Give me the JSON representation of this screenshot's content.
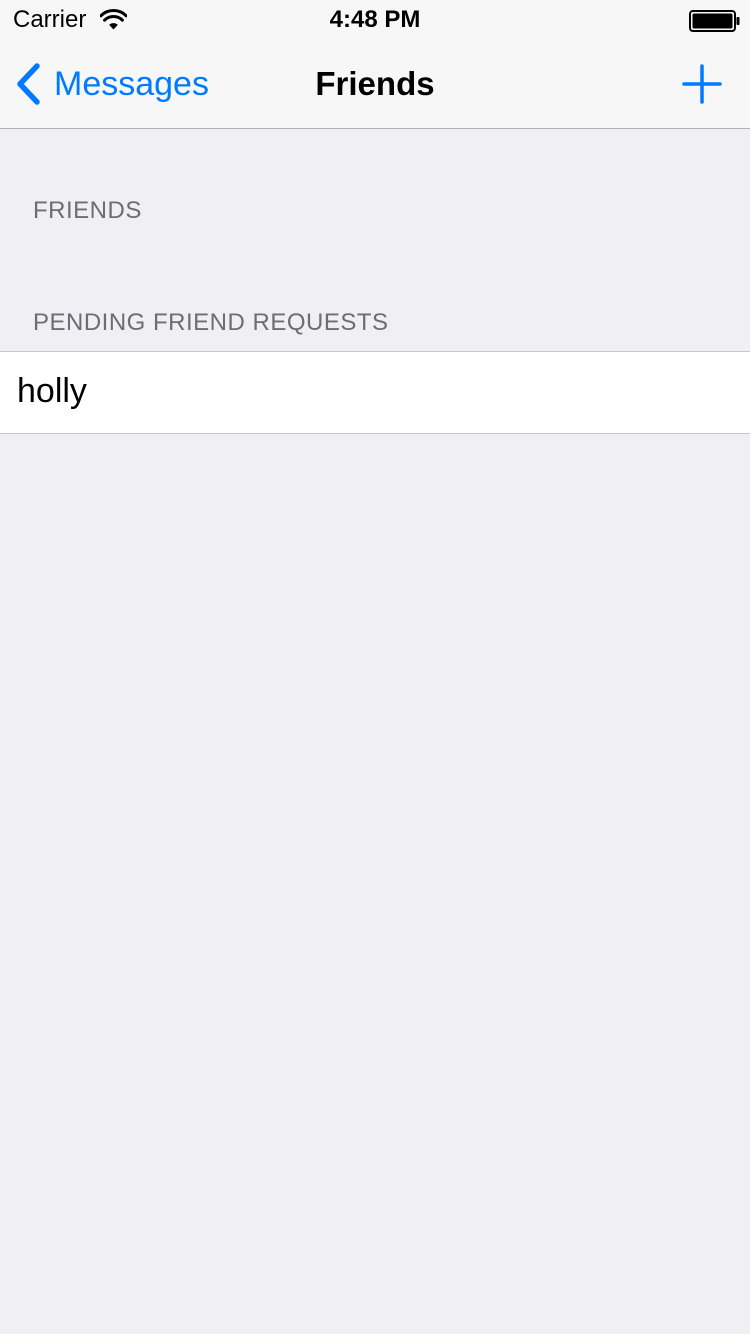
{
  "status_bar": {
    "carrier": "Carrier",
    "time": "4:48 PM"
  },
  "nav": {
    "back_label": "Messages",
    "title": "Friends",
    "add_icon": "plus-icon"
  },
  "sections": {
    "friends_header": "FRIENDS",
    "pending_header": "PENDING FRIEND REQUESTS"
  },
  "pending_requests": [
    {
      "name": "holly"
    }
  ],
  "colors": {
    "accent": "#007aff",
    "background": "#efeff4",
    "header_text": "#6d6d72"
  }
}
